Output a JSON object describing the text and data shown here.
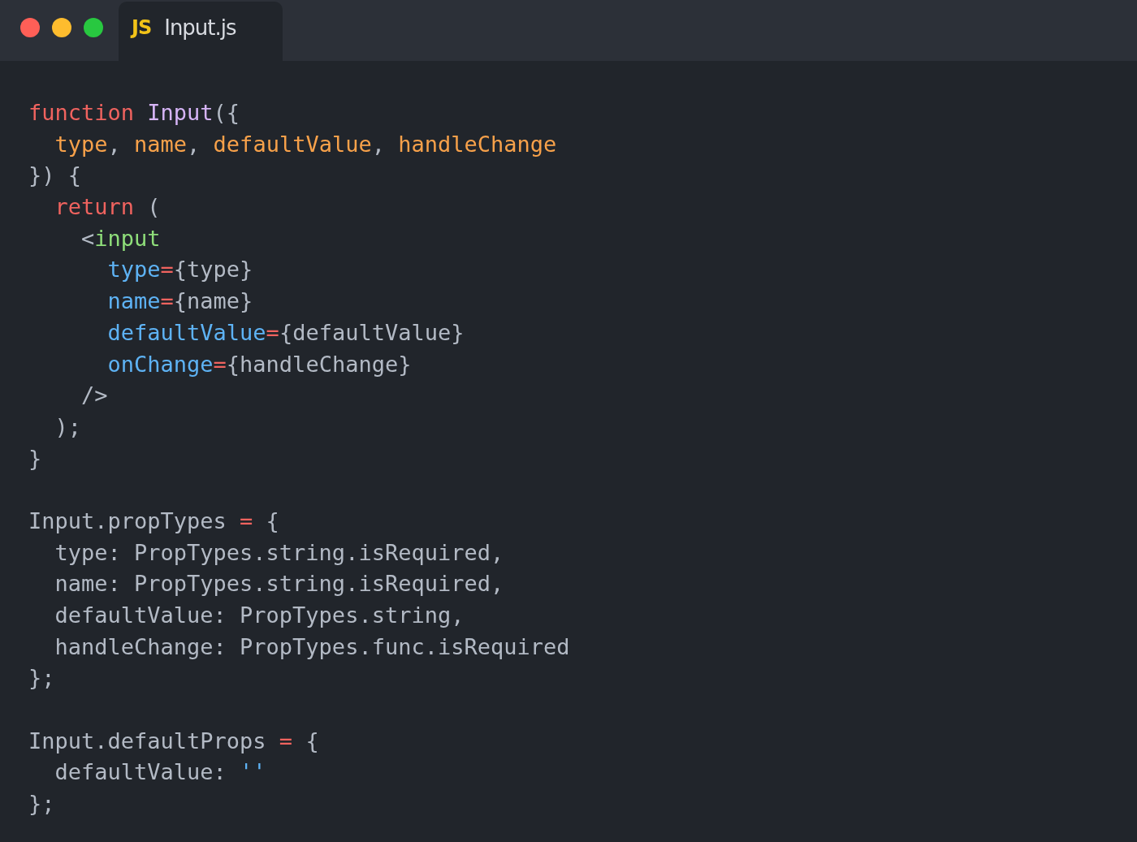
{
  "window_buttons": [
    {
      "kind": "close"
    },
    {
      "kind": "minimize"
    },
    {
      "kind": "zoom"
    }
  ],
  "tabs": [
    {
      "icon_text": "JS",
      "label": "Input.js",
      "selected": true
    }
  ],
  "code_lines": [
    {
      "kind": "code",
      "tokens": [
        {
          "kind": "keyword",
          "text": "function "
        },
        {
          "kind": "function",
          "text": "Input"
        },
        {
          "kind": "plain",
          "text": "({"
        }
      ]
    },
    {
      "kind": "code",
      "tokens": [
        {
          "kind": "param",
          "text": "  type"
        },
        {
          "kind": "plain",
          "text": ", "
        },
        {
          "kind": "param",
          "text": "name"
        },
        {
          "kind": "plain",
          "text": ", "
        },
        {
          "kind": "param",
          "text": "defaultValue"
        },
        {
          "kind": "plain",
          "text": ", "
        },
        {
          "kind": "param",
          "text": "handleChange"
        }
      ]
    },
    {
      "kind": "code",
      "tokens": [
        {
          "kind": "plain",
          "text": "}) {"
        }
      ]
    },
    {
      "kind": "code",
      "tokens": [
        {
          "kind": "keyword",
          "text": "  return"
        },
        {
          "kind": "plain",
          "text": " ("
        }
      ]
    },
    {
      "kind": "code",
      "tokens": [
        {
          "kind": "plain",
          "text": "    <"
        },
        {
          "kind": "tag",
          "text": "input"
        }
      ]
    },
    {
      "kind": "code",
      "tokens": [
        {
          "kind": "attr",
          "text": "      type"
        },
        {
          "kind": "operator",
          "text": "="
        },
        {
          "kind": "plain",
          "text": "{type}"
        }
      ]
    },
    {
      "kind": "code",
      "tokens": [
        {
          "kind": "attr",
          "text": "      name"
        },
        {
          "kind": "operator",
          "text": "="
        },
        {
          "kind": "plain",
          "text": "{name}"
        }
      ]
    },
    {
      "kind": "code",
      "tokens": [
        {
          "kind": "attr",
          "text": "      defaultValue"
        },
        {
          "kind": "operator",
          "text": "="
        },
        {
          "kind": "plain",
          "text": "{defaultValue}"
        }
      ]
    },
    {
      "kind": "code",
      "tokens": [
        {
          "kind": "attr",
          "text": "      onChange"
        },
        {
          "kind": "operator",
          "text": "="
        },
        {
          "kind": "plain",
          "text": "{handleChange}"
        }
      ]
    },
    {
      "kind": "code",
      "tokens": [
        {
          "kind": "plain",
          "text": "    />"
        }
      ]
    },
    {
      "kind": "code",
      "tokens": [
        {
          "kind": "plain",
          "text": "  );"
        }
      ]
    },
    {
      "kind": "code",
      "tokens": [
        {
          "kind": "plain",
          "text": "}"
        }
      ]
    },
    {
      "kind": "blank"
    },
    {
      "kind": "code",
      "tokens": [
        {
          "kind": "plain",
          "text": "Input.propTypes "
        },
        {
          "kind": "operator",
          "text": "="
        },
        {
          "kind": "plain",
          "text": " {"
        }
      ]
    },
    {
      "kind": "code",
      "tokens": [
        {
          "kind": "plain",
          "text": "  type: PropTypes.string.isRequired,"
        }
      ]
    },
    {
      "kind": "code",
      "tokens": [
        {
          "kind": "plain",
          "text": "  name: PropTypes.string.isRequired,"
        }
      ]
    },
    {
      "kind": "code",
      "tokens": [
        {
          "kind": "plain",
          "text": "  defaultValue: PropTypes.string,"
        }
      ]
    },
    {
      "kind": "code",
      "tokens": [
        {
          "kind": "plain",
          "text": "  handleChange: PropTypes.func.isRequired"
        }
      ]
    },
    {
      "kind": "code",
      "tokens": [
        {
          "kind": "plain",
          "text": "};"
        }
      ]
    },
    {
      "kind": "blank"
    },
    {
      "kind": "code",
      "tokens": [
        {
          "kind": "plain",
          "text": "Input.defaultProps "
        },
        {
          "kind": "operator",
          "text": "="
        },
        {
          "kind": "plain",
          "text": " {"
        }
      ]
    },
    {
      "kind": "code",
      "tokens": [
        {
          "kind": "plain",
          "text": "  defaultValue: "
        },
        {
          "kind": "string",
          "text": "''"
        }
      ]
    },
    {
      "kind": "code",
      "tokens": [
        {
          "kind": "plain",
          "text": "};"
        }
      ]
    }
  ]
}
